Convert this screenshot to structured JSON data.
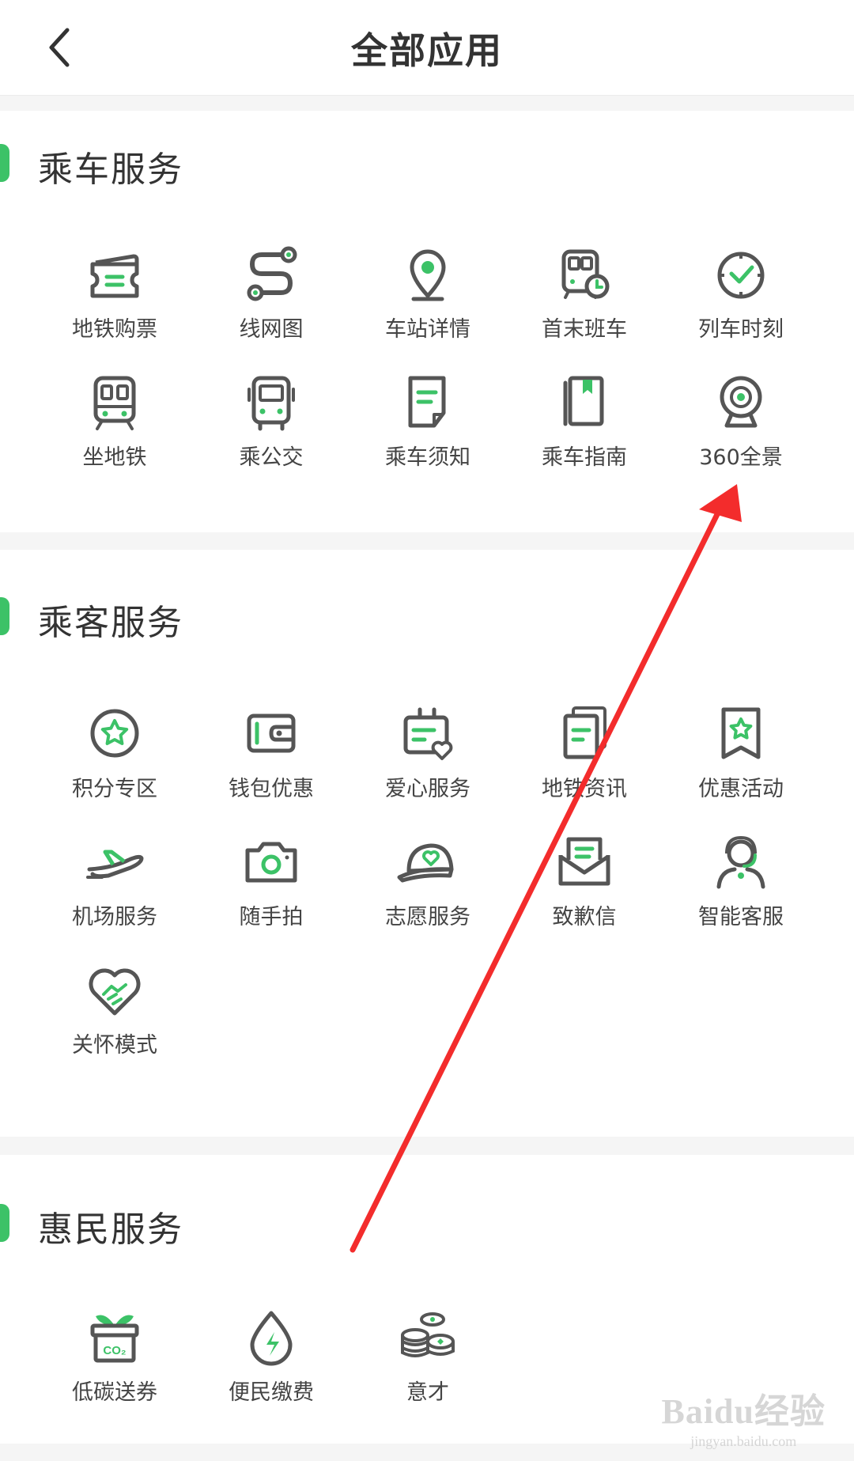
{
  "header": {
    "title": "全部应用",
    "back_icon": "chevron-left-icon"
  },
  "colors": {
    "accent": "#3cc267",
    "icon_gray": "#555555",
    "arrow": "#f32c2c"
  },
  "sections": [
    {
      "title": "乘车服务",
      "apps": [
        {
          "label": "地铁购票",
          "icon": "ticket-icon"
        },
        {
          "label": "线网图",
          "icon": "route-map-icon"
        },
        {
          "label": "车站详情",
          "icon": "location-pin-icon"
        },
        {
          "label": "首末班车",
          "icon": "train-clock-icon"
        },
        {
          "label": "列车时刻",
          "icon": "clock-icon"
        },
        {
          "label": "坐地铁",
          "icon": "metro-icon"
        },
        {
          "label": "乘公交",
          "icon": "bus-icon"
        },
        {
          "label": "乘车须知",
          "icon": "notice-doc-icon"
        },
        {
          "label": "乘车指南",
          "icon": "guide-book-icon"
        },
        {
          "label": "360全景",
          "icon": "panorama-camera-icon"
        }
      ]
    },
    {
      "title": "乘客服务",
      "apps": [
        {
          "label": "积分专区",
          "icon": "star-badge-icon"
        },
        {
          "label": "钱包优惠",
          "icon": "wallet-icon"
        },
        {
          "label": "爱心服务",
          "icon": "love-service-icon"
        },
        {
          "label": "地铁资讯",
          "icon": "news-icon"
        },
        {
          "label": "优惠活动",
          "icon": "star-bookmark-icon"
        },
        {
          "label": "机场服务",
          "icon": "airplane-icon"
        },
        {
          "label": "随手拍",
          "icon": "camera-icon"
        },
        {
          "label": "志愿服务",
          "icon": "cap-icon"
        },
        {
          "label": "致歉信",
          "icon": "letter-icon"
        },
        {
          "label": "智能客服",
          "icon": "customer-service-icon"
        },
        {
          "label": "关怀模式",
          "icon": "care-handshake-icon"
        }
      ]
    },
    {
      "title": "惠民服务",
      "apps": [
        {
          "label": "低碳送券",
          "icon": "co2-gift-icon"
        },
        {
          "label": "便民缴费",
          "icon": "energy-drop-icon"
        },
        {
          "label": "意才",
          "icon": "coins-icon"
        }
      ]
    }
  ],
  "watermark": {
    "logo": "Baidu经验",
    "url": "jingyan.baidu.com"
  }
}
